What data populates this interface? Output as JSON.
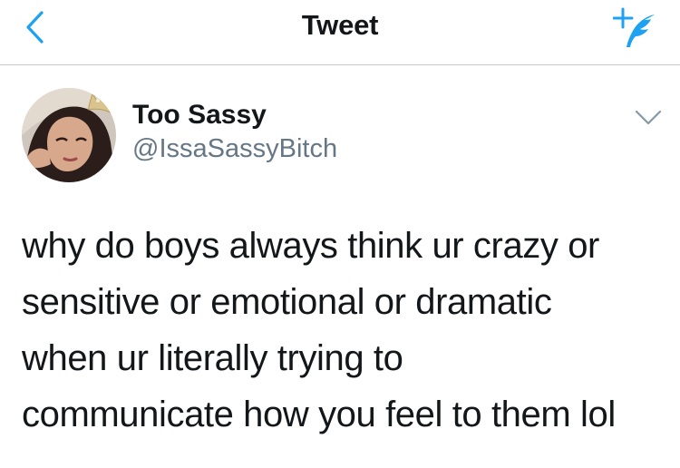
{
  "nav": {
    "title": "Tweet",
    "back_icon": "chevron-left-icon",
    "compose_icon": "compose-tweet-icon",
    "accent_color": "#1da1f2"
  },
  "author": {
    "display_name": "Too Sassy",
    "handle": "@IssaSassyBitch",
    "avatar_icon": "profile-photo",
    "menu_icon": "chevron-down-icon"
  },
  "tweet": {
    "lines": [
      "why do boys always think ur crazy or",
      "sensitive or emotional or dramatic",
      "when ur literally trying to",
      "communicate how you feel to them lol"
    ]
  }
}
